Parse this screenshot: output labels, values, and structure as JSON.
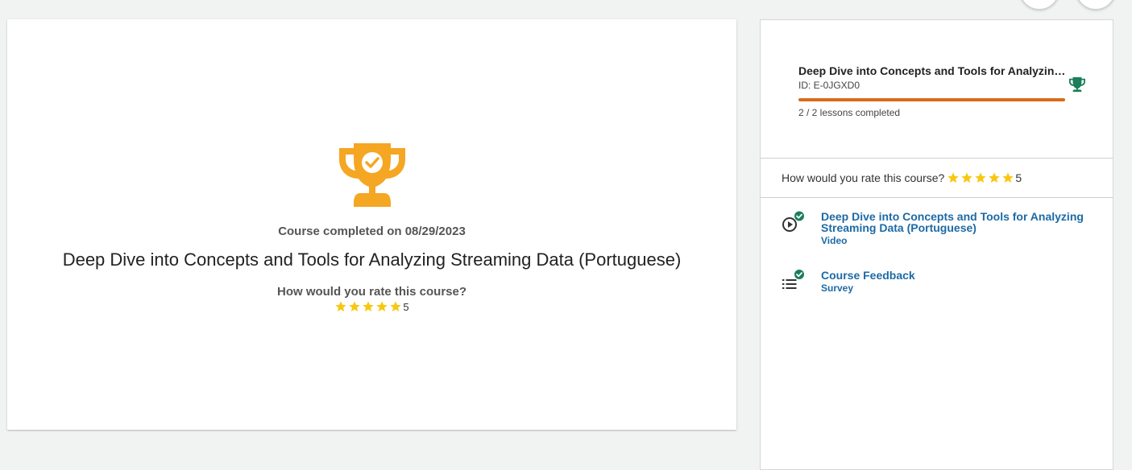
{
  "main": {
    "completed_text": "Course completed on 08/29/2023",
    "course_title": "Deep Dive into Concepts and Tools for Analyzing Streaming Data (Portuguese)",
    "rating_question": "How would you rate this course?",
    "rating_value": "5",
    "trophy_icon": "trophy-check-icon",
    "trophy_color": "#f5a623"
  },
  "sidebar": {
    "course_title": "Deep Dive into Concepts and Tools for Analyzing Streaming Data (Portuguese)",
    "course_id": "ID: E-0JGXD0",
    "progress_fraction": 1.0,
    "progress_color": "#d86b1d",
    "lessons_completed": "2 / 2 lessons completed",
    "trophy_icon": "trophy-icon",
    "trophy_color": "#1a7f5a",
    "rating_question": "How would you rate this course?",
    "rating_value": "5",
    "star_color": "#f7c812",
    "lessons": [
      {
        "title": "Deep Dive into Concepts and Tools for Analyzing Streaming Data (Portuguese)",
        "type": "Video",
        "icon": "play-circle-icon",
        "completed": true
      },
      {
        "title": "Course Feedback",
        "type": "Survey",
        "icon": "list-icon",
        "completed": true
      }
    ]
  }
}
